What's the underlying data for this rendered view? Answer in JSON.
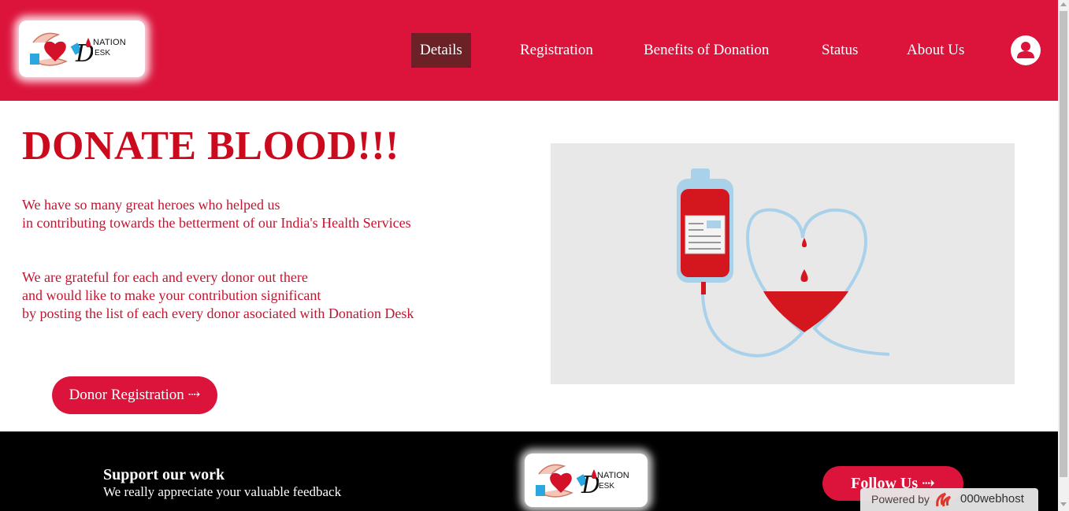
{
  "header": {
    "logo": {
      "word_top": "NATION",
      "word_bottom": "ESK"
    },
    "nav": [
      {
        "label": "Details",
        "active": true
      },
      {
        "label": "Registration",
        "active": false
      },
      {
        "label": "Benefits of Donation",
        "active": false
      },
      {
        "label": "Status",
        "active": false
      },
      {
        "label": "About Us",
        "active": false
      }
    ],
    "profile_icon": "user-icon"
  },
  "main": {
    "headline": "DONATE BLOOD!!!",
    "paragraph1": [
      "We have so many great heroes who helped us",
      "in contributing towards the betterment of our India's Health Services"
    ],
    "paragraph2": [
      "We are grateful for each and every donor out there",
      "and would like to make your contribution significant",
      "by posting the list of each every donor asociated with Donation Desk"
    ],
    "donor_button": "Donor Registration ⇢"
  },
  "footer": {
    "support_title": "Support our work",
    "support_subtitle": "We really appreciate your valuable feedback",
    "follow_button": "Follow Us ⇢",
    "powered_by": "Powered by",
    "powered_brand": "000webhost"
  },
  "colors": {
    "primary": "#dc143c",
    "active_nav": "#6b2125",
    "headline": "#cc0a1e",
    "footer_bg": "#000000"
  }
}
